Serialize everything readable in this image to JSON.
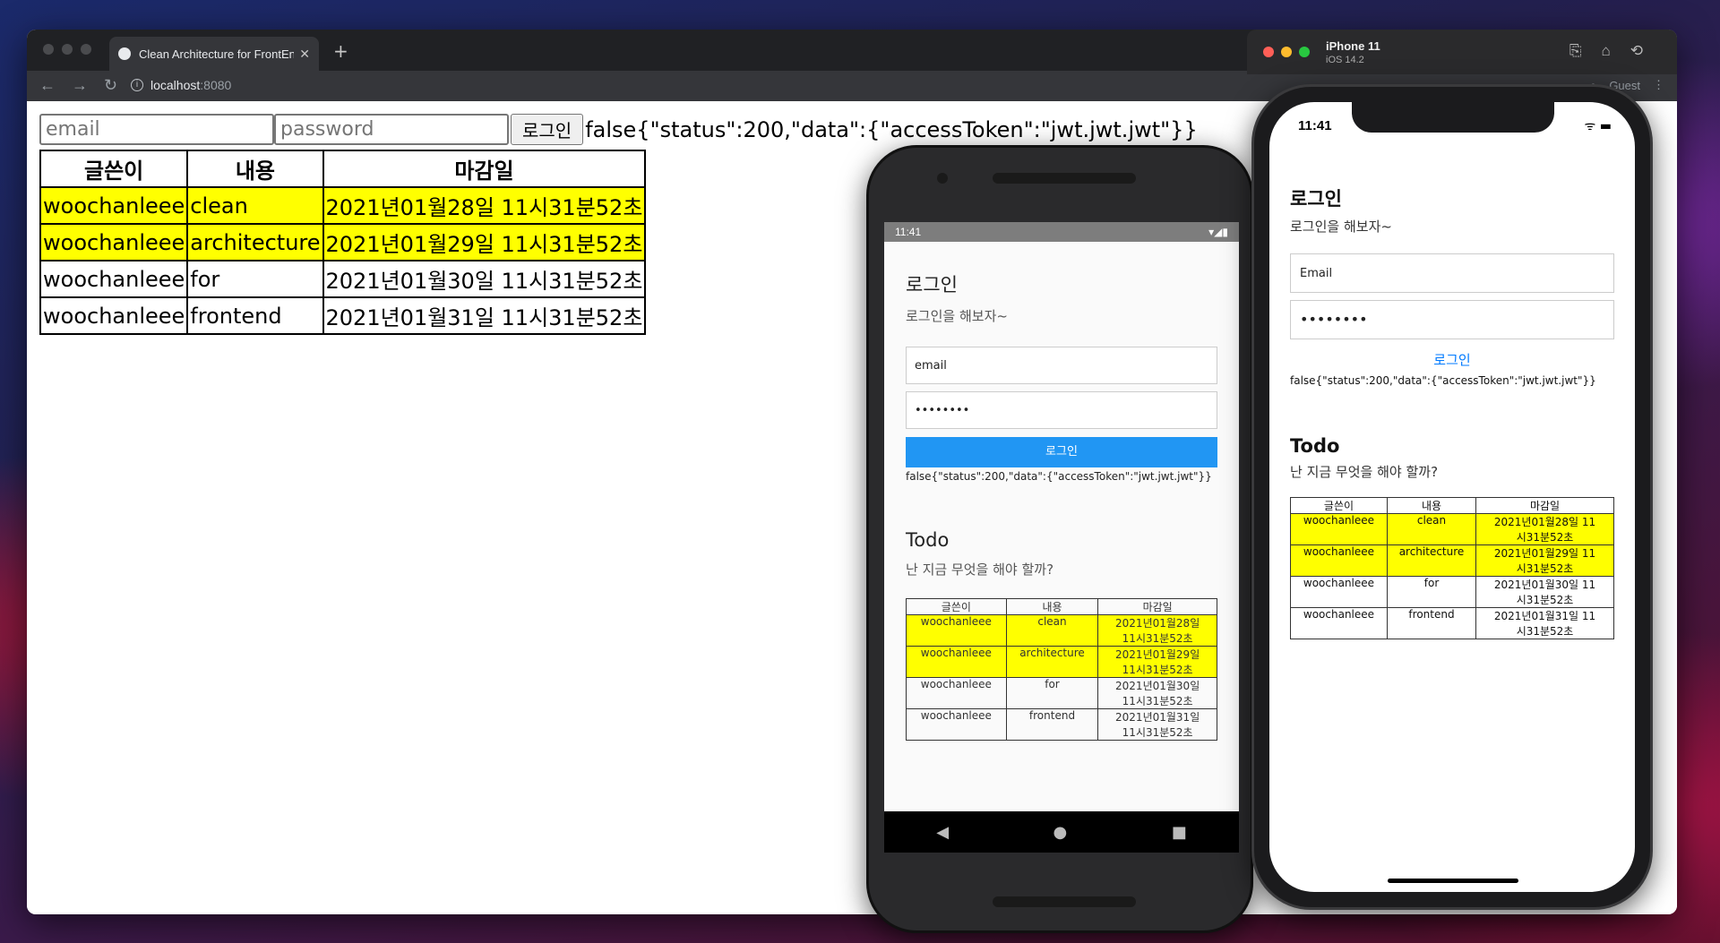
{
  "browser": {
    "tab_title": "Clean Architecture for FrontEnd",
    "url_host": "localhost",
    "url_port": ":8080",
    "profile_label": "Guest"
  },
  "web": {
    "email_placeholder": "email",
    "password_placeholder": "password",
    "login_button": "로그인",
    "result_text": "false{\"status\":200,\"data\":{\"accessToken\":\"jwt.jwt.jwt\"}}",
    "table_headers": [
      "글쓴이",
      "내용",
      "마감일"
    ],
    "rows": [
      {
        "author": "woochanleee",
        "content": "clean",
        "deadline": "2021년01월28일 11시31분52초",
        "highlight": true
      },
      {
        "author": "woochanleee",
        "content": "architecture",
        "deadline": "2021년01월29일 11시31분52초",
        "highlight": true
      },
      {
        "author": "woochanleee",
        "content": "for",
        "deadline": "2021년01월30일 11시31분52초",
        "highlight": false
      },
      {
        "author": "woochanleee",
        "content": "frontend",
        "deadline": "2021년01월31일 11시31분52초",
        "highlight": false
      }
    ]
  },
  "android": {
    "status_time": "11:41",
    "login_title": "로그인",
    "login_sub": "로그인을 해보자~",
    "email_value": "email",
    "password_value": "••••••••",
    "login_button": "로그인",
    "result_text": "false{\"status\":200,\"data\":{\"accessToken\":\"jwt.jwt.jwt\"}}",
    "todo_title": "Todo",
    "todo_sub": "난 지금 무엇을 해야 할까?",
    "deadline_lines": [
      [
        "2021년01월28일",
        "11시31분52초"
      ],
      [
        "2021년01월29일",
        "11시31분52초"
      ],
      [
        "2021년01월30일",
        "11시31분52초"
      ],
      [
        "2021년01월31일",
        "11시31분52초"
      ]
    ]
  },
  "iphone": {
    "sim_name": "iPhone 11",
    "sim_os": "iOS 14.2",
    "status_time": "11:41",
    "login_title": "로그인",
    "login_sub": "로그인을 해보자~",
    "email_value": "Email",
    "password_value": "••••••••",
    "login_button": "로그인",
    "result_text": "false{\"status\":200,\"data\":{\"accessToken\":\"jwt.jwt.jwt\"}}",
    "todo_title": "Todo",
    "todo_sub": "난 지금 무엇을 해야 할까?",
    "deadline_lines": [
      [
        "2021년01월28일 11",
        "시31분52초"
      ],
      [
        "2021년01월29일 11",
        "시31분52초"
      ],
      [
        "2021년01월30일 11",
        "시31분52초"
      ],
      [
        "2021년01월31일 11",
        "시31분52초"
      ]
    ]
  },
  "colors": {
    "highlight": "#ffff00",
    "android_button": "#2196f3",
    "ios_link": "#007aff"
  }
}
